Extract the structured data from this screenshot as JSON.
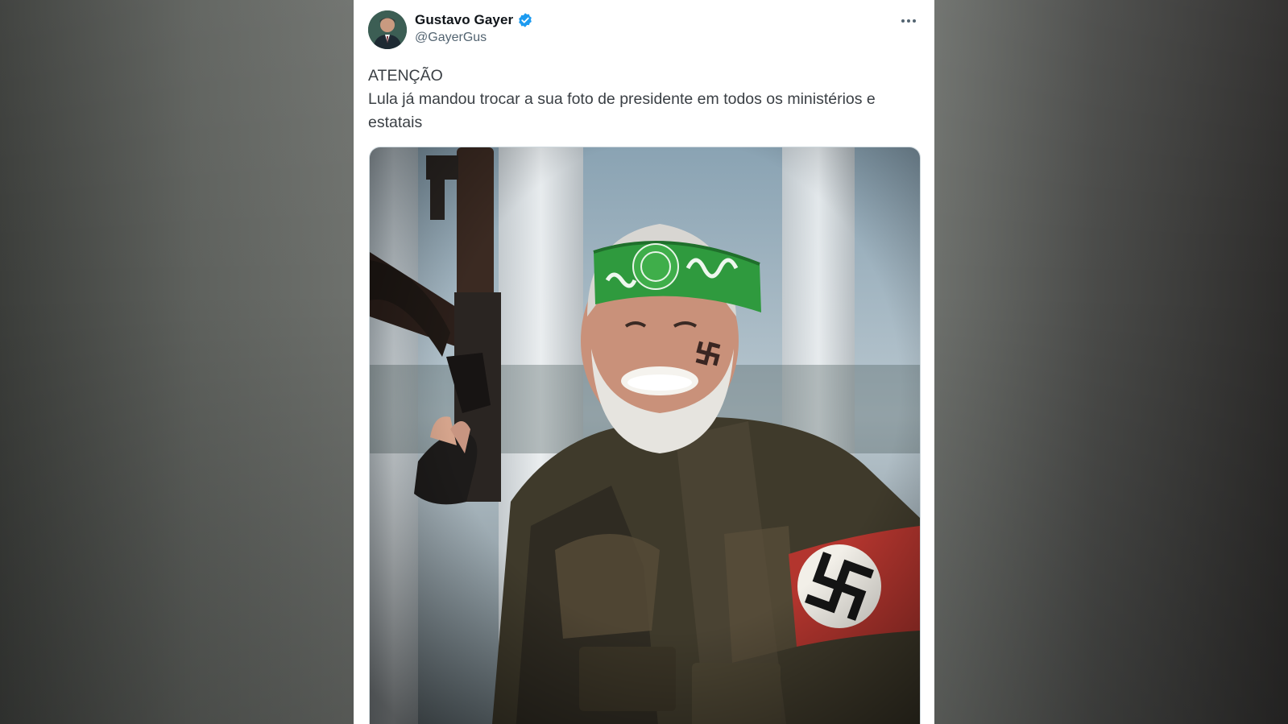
{
  "tweet": {
    "author": {
      "display_name": "Gustavo Gayer",
      "handle": "@GayerGus",
      "verified": true,
      "verified_color": "#1d9bf0",
      "avatar_icon": "profile-photo"
    },
    "more_icon": "ellipsis-icon",
    "text_lines": [
      "ATENÇÃO",
      "Lula já mandou trocar a sua foto de presidente em todos os ministérios e",
      "estatais"
    ],
    "media": {
      "type": "photo"
    }
  },
  "colors": {
    "name_text": "#0f1419",
    "secondary_text": "#536471",
    "body_text": "#3a3f44"
  }
}
